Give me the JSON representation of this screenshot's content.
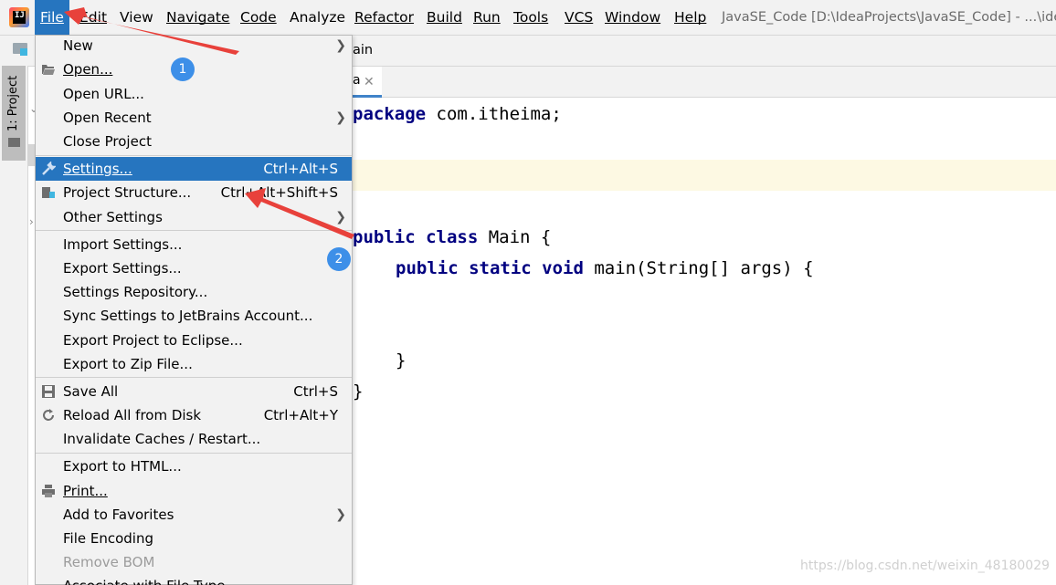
{
  "menubar": {
    "items": [
      "File",
      "Edit",
      "View",
      "Navigate",
      "Code",
      "Analyze",
      "Refactor",
      "Build",
      "Run",
      "Tools",
      "VCS",
      "Window",
      "Help"
    ],
    "title": "JavaSE_Code [D:\\IdeaProjects\\JavaSE_Code] - ...\\ide"
  },
  "navbar": {
    "crumb": "ain"
  },
  "toolstrip": {
    "project_tab": "1: Project"
  },
  "editor_tab": {
    "label": "a"
  },
  "file_menu": {
    "new": "New",
    "open": "Open...",
    "open_url": "Open URL...",
    "open_recent": "Open Recent",
    "close_project": "Close Project",
    "settings": "Settings...",
    "settings_shortcut": "Ctrl+Alt+S",
    "project_structure": "Project Structure...",
    "project_structure_shortcut": "Ctrl+Alt+Shift+S",
    "other_settings": "Other Settings",
    "import_settings": "Import Settings...",
    "export_settings": "Export Settings...",
    "settings_repository": "Settings Repository...",
    "sync_settings": "Sync Settings to JetBrains Account...",
    "export_eclipse": "Export Project to Eclipse...",
    "export_zip": "Export to Zip File...",
    "save_all": "Save All",
    "save_all_shortcut": "Ctrl+S",
    "reload": "Reload All from Disk",
    "reload_shortcut": "Ctrl+Alt+Y",
    "invalidate": "Invalidate Caches / Restart...",
    "export_html": "Export to HTML...",
    "print": "Print...",
    "add_favorites": "Add to Favorites",
    "file_encoding": "File Encoding",
    "remove_bom": "Remove BOM",
    "associate": "Associate with File Type..."
  },
  "code": {
    "l1_kw": "package",
    "l1_rest": " com.itheima;",
    "l2_kw": "public class",
    "l2_rest": " Main {",
    "l3_kw": "public static void",
    "l3_rest": " main(String[] args) {",
    "l4": "}",
    "l5": "}"
  },
  "annotations": {
    "badge1": "1",
    "badge2": "2"
  },
  "watermark": "https://blog.csdn.net/weixin_48180029",
  "colors": {
    "selection": "#2675bf",
    "keyword": "#000080",
    "arrow": "#e8413b",
    "badge": "#3d8fe8",
    "caret_line": "#fdf9e3"
  }
}
